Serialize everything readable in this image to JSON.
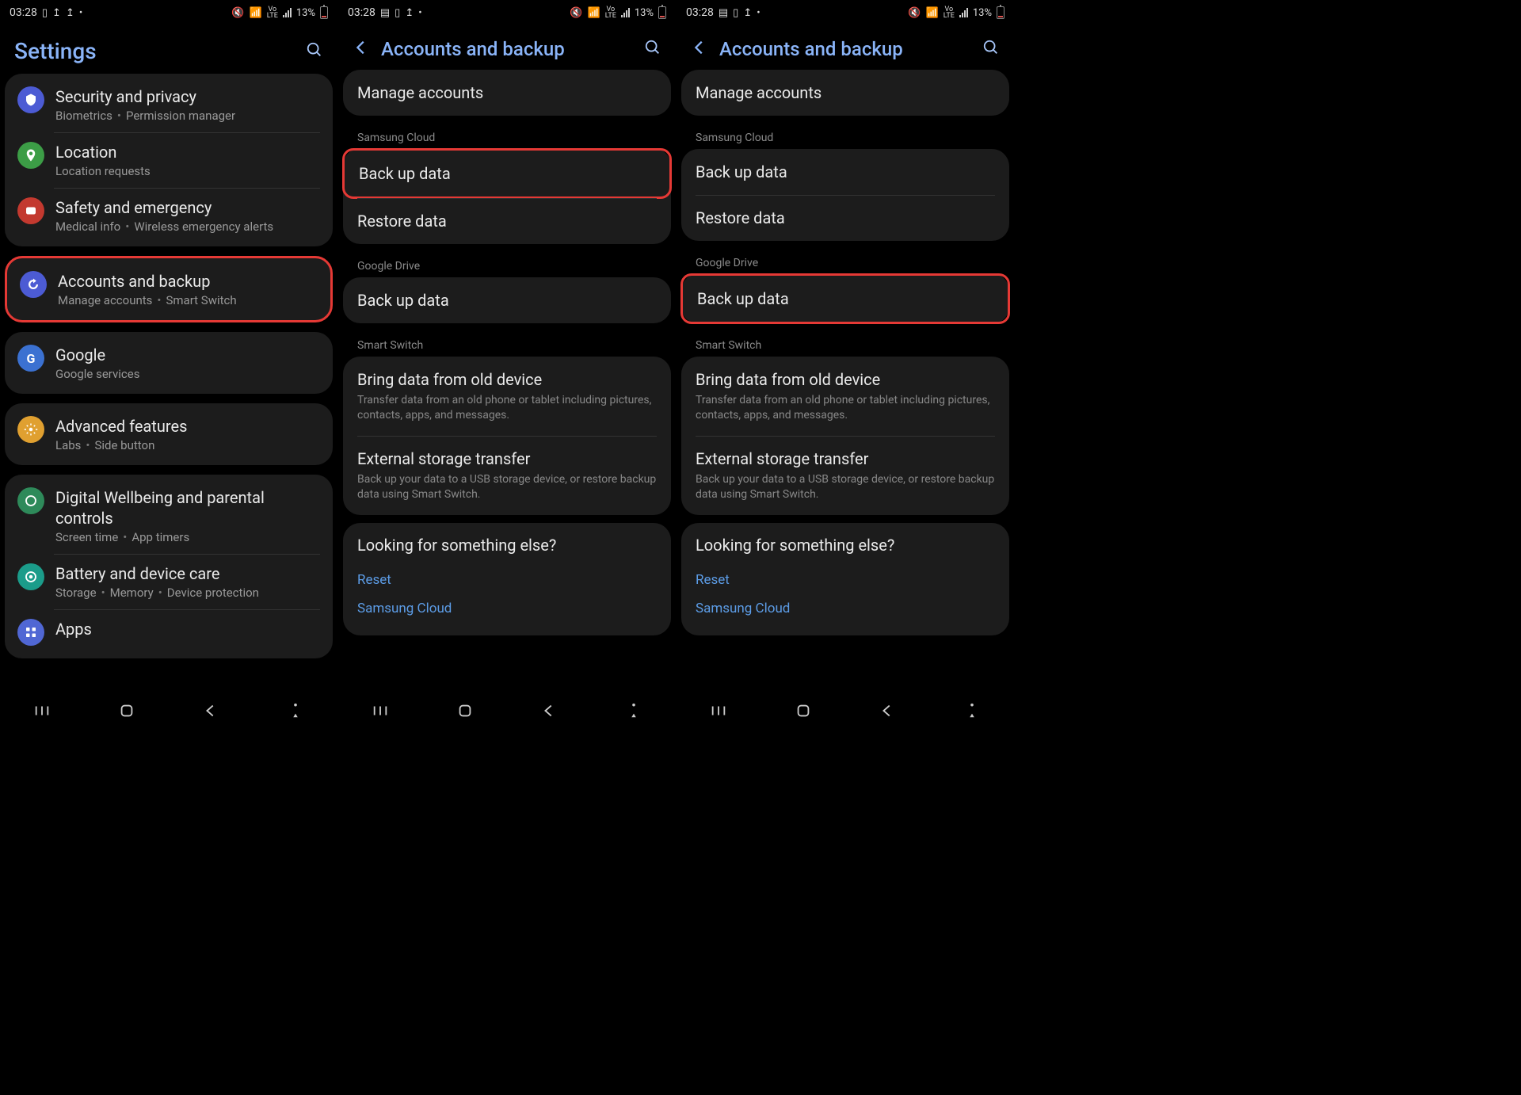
{
  "status": {
    "time": "03:28",
    "battery": "13%"
  },
  "panel1": {
    "title": "Settings",
    "groups": [
      {
        "items": [
          {
            "title": "Security and privacy",
            "sub1": "Biometrics",
            "sub2": "Permission manager",
            "color": "#4c5bd4",
            "icon": "shield"
          },
          {
            "title": "Location",
            "sub1": "Location requests",
            "color": "#3c9d46",
            "icon": "pin"
          },
          {
            "title": "Safety and emergency",
            "sub1": "Medical info",
            "sub2": "Wireless emergency alerts",
            "color": "#c3392f",
            "icon": "alert"
          }
        ]
      },
      {
        "highlight": true,
        "items": [
          {
            "title": "Accounts and backup",
            "sub1": "Manage accounts",
            "sub2": "Smart Switch",
            "color": "#4c5bd4",
            "icon": "sync"
          }
        ]
      },
      {
        "items": [
          {
            "title": "Google",
            "sub1": "Google services",
            "color": "#3b71d1",
            "icon": "g"
          }
        ]
      },
      {
        "items": [
          {
            "title": "Advanced features",
            "sub1": "Labs",
            "sub2": "Side button",
            "color": "#e0a030",
            "icon": "gear"
          }
        ]
      },
      {
        "items": [
          {
            "title": "Digital Wellbeing and parental controls",
            "sub1": "Screen time",
            "sub2": "App timers",
            "color": "#2e8a5a",
            "icon": "circle"
          },
          {
            "title": "Battery and device care",
            "sub1": "Storage",
            "sub2": "Memory",
            "sub3": "Device protection",
            "color": "#1b9c8a",
            "icon": "ring"
          },
          {
            "title": "Apps",
            "color": "#5067d4",
            "icon": "grid"
          }
        ]
      }
    ]
  },
  "panel2": {
    "title": "Accounts and backup",
    "sections": {
      "manage": "Manage accounts",
      "sc_header": "Samsung Cloud",
      "sc_backup": "Back up data",
      "sc_restore": "Restore data",
      "gd_header": "Google Drive",
      "gd_backup": "Back up data",
      "ss_header": "Smart Switch",
      "ss_bring_t": "Bring data from old device",
      "ss_bring_s": "Transfer data from an old phone or tablet including pictures, contacts, apps, and messages.",
      "ss_ext_t": "External storage transfer",
      "ss_ext_s": "Back up your data to a USB storage device, or restore backup data using Smart Switch."
    },
    "looking": {
      "title": "Looking for something else?",
      "l1": "Reset",
      "l2": "Samsung Cloud"
    },
    "highlight": "sc_backup"
  },
  "panel3": {
    "highlight": "gd_backup"
  }
}
